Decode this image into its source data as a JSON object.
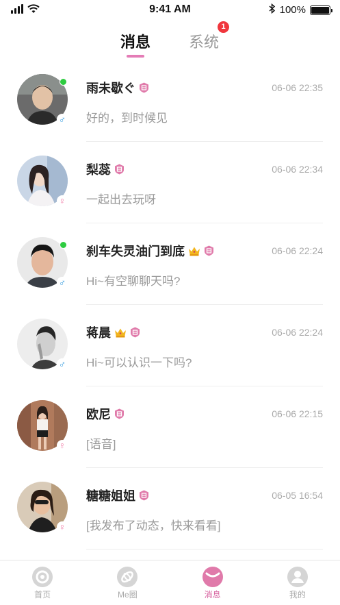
{
  "status_bar": {
    "time": "9:41 AM",
    "battery": "100%"
  },
  "tabs": {
    "messages_label": "消息",
    "system_label": "系统",
    "system_badge": "1"
  },
  "messages": [
    {
      "name": "雨未歇ぐ",
      "time": "06-06 22:35",
      "preview": "好的，到时候见",
      "gender": "♂",
      "online": true,
      "crown": false
    },
    {
      "name": "梨蕊",
      "time": "06-06 22:34",
      "preview": "一起出去玩呀",
      "gender": "♀",
      "online": false,
      "crown": false
    },
    {
      "name": "刹车失灵油门到底",
      "time": "06-06 22:24",
      "preview": "Hi~有空聊聊天吗?",
      "gender": "♂",
      "online": true,
      "crown": true
    },
    {
      "name": "蒋晨",
      "time": "06-06 22:24",
      "preview": "Hi~可以认识一下吗?",
      "gender": "♂",
      "online": false,
      "crown": true
    },
    {
      "name": "欧尼",
      "time": "06-06 22:15",
      "preview": "[语音]",
      "gender": "♀",
      "online": false,
      "crown": false
    },
    {
      "name": "糖糖姐姐",
      "time": "06-05 16:54",
      "preview": "[我发布了动态，快来看看]",
      "gender": "♀",
      "online": false,
      "crown": false
    }
  ],
  "bottom_nav": [
    {
      "label": "首页",
      "icon": "home-icon"
    },
    {
      "label": "Me圈",
      "icon": "moments-icon"
    },
    {
      "label": "消息",
      "icon": "messages-icon"
    },
    {
      "label": "我的",
      "icon": "profile-icon"
    }
  ],
  "colors": {
    "accent": "#e47cb6",
    "badge": "#f0363d",
    "online": "#2ecc40",
    "male": "#3a9ee0",
    "female": "#f07aa6"
  }
}
